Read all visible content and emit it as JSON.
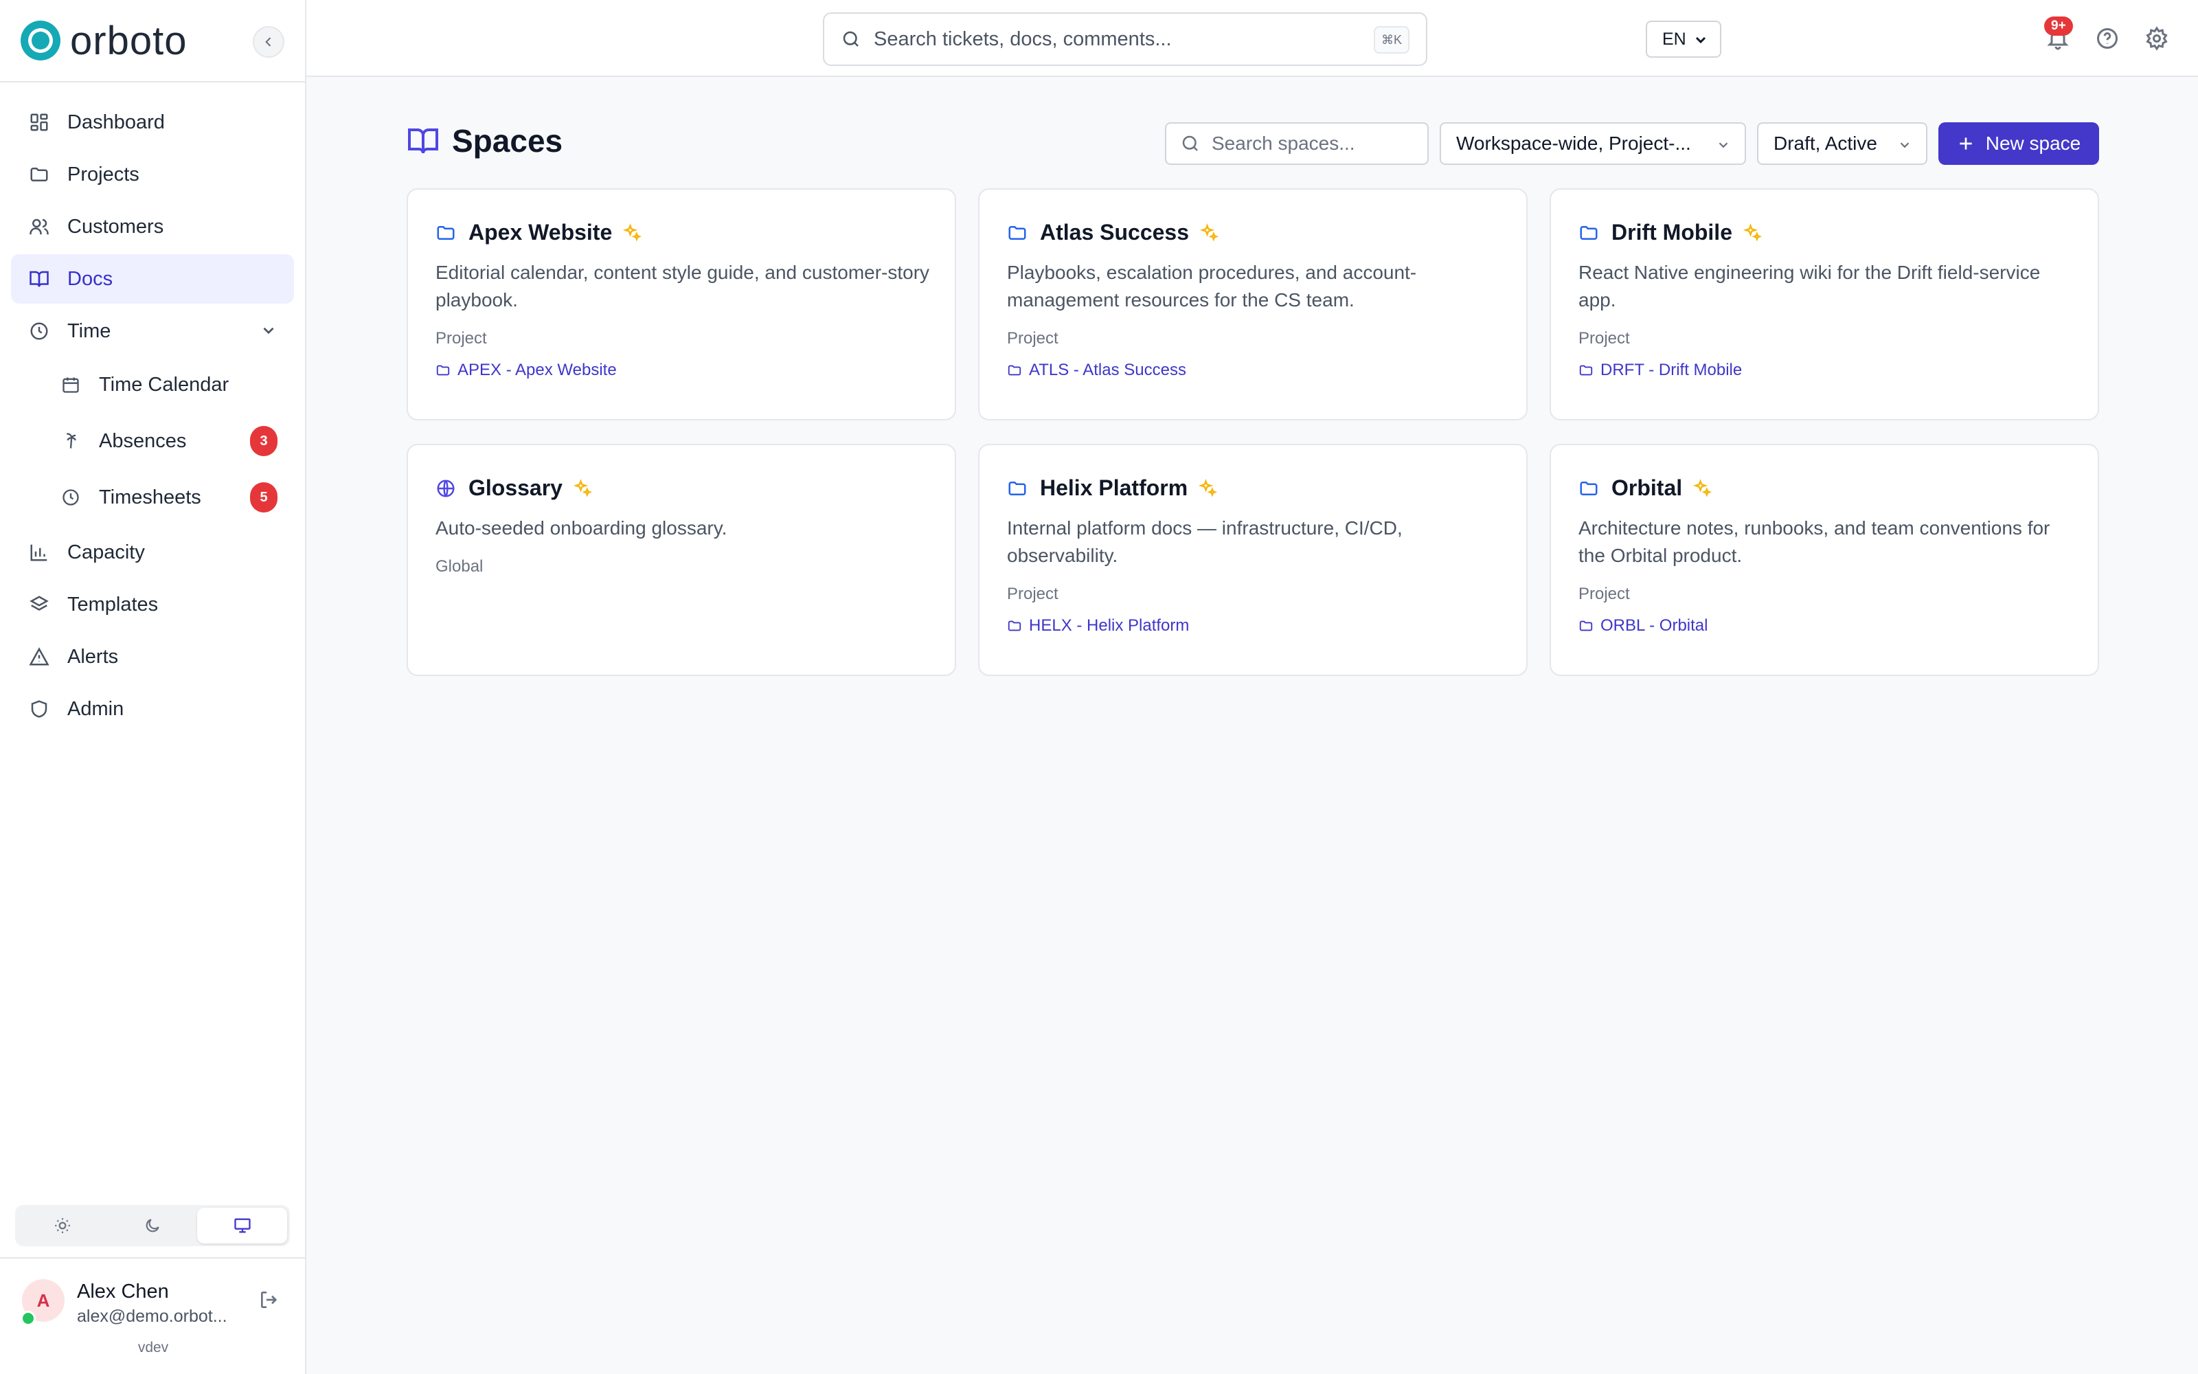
{
  "app": {
    "name": "orboto",
    "version": "vdev"
  },
  "sidebar": {
    "items": [
      {
        "label": "Dashboard",
        "icon": "dashboard-icon"
      },
      {
        "label": "Projects",
        "icon": "folder-icon"
      },
      {
        "label": "Customers",
        "icon": "users-icon"
      },
      {
        "label": "Docs",
        "icon": "book-icon",
        "active": true
      },
      {
        "label": "Time",
        "icon": "clock-icon",
        "expanded": true
      },
      {
        "label": "Time Calendar",
        "icon": "calendar-icon"
      },
      {
        "label": "Absences",
        "icon": "palm-tree-icon",
        "badge": "3"
      },
      {
        "label": "Timesheets",
        "icon": "clock-icon",
        "badge": "5"
      },
      {
        "label": "Capacity",
        "icon": "bar-chart-icon"
      },
      {
        "label": "Templates",
        "icon": "layers-icon"
      },
      {
        "label": "Alerts",
        "icon": "alert-triangle-icon"
      },
      {
        "label": "Admin",
        "icon": "shield-icon"
      }
    ],
    "theme_options": [
      "light",
      "dark",
      "system"
    ],
    "theme_selected": "system"
  },
  "user": {
    "name": "Alex Chen",
    "email": "alex@demo.orbot...",
    "initial": "A",
    "status_color": "#22c55e"
  },
  "topbar": {
    "search_placeholder": "Search tickets, docs, comments...",
    "shortcut": "⌘K",
    "language": "EN",
    "notifications_badge": "9+"
  },
  "page": {
    "title": "Spaces",
    "search_placeholder": "Search spaces...",
    "scope_filter": "Workspace-wide, Project-...",
    "status_filter": "Draft, Active",
    "new_button": "New space"
  },
  "spaces": [
    {
      "title": "Apex Website",
      "icon": "folder-icon",
      "description": "Editorial calendar, content style guide, and customer-story playbook.",
      "scope": "Project",
      "link": "APEX - Apex Website"
    },
    {
      "title": "Atlas Success",
      "icon": "folder-icon",
      "description": "Playbooks, escalation procedures, and account-management resources for the CS team.",
      "scope": "Project",
      "link": "ATLS - Atlas Success"
    },
    {
      "title": "Drift Mobile",
      "icon": "folder-icon",
      "description": "React Native engineering wiki for the Drift field-service app.",
      "scope": "Project",
      "link": "DRFT - Drift Mobile"
    },
    {
      "title": "Glossary",
      "icon": "globe-icon",
      "description": "Auto-seeded onboarding glossary.",
      "scope": "Global",
      "link": ""
    },
    {
      "title": "Helix Platform",
      "icon": "folder-icon",
      "description": "Internal platform docs — infrastructure, CI/CD, observability.",
      "scope": "Project",
      "link": "HELX - Helix Platform"
    },
    {
      "title": "Orbital",
      "icon": "folder-icon",
      "description": "Architecture notes, runbooks, and team conventions for the Orbital product.",
      "scope": "Project",
      "link": "ORBL - Orbital"
    }
  ],
  "colors": {
    "accent": "#4338ca",
    "brand": "#14a9b5",
    "badge": "#e5373a",
    "spark": "#f5b50a"
  }
}
